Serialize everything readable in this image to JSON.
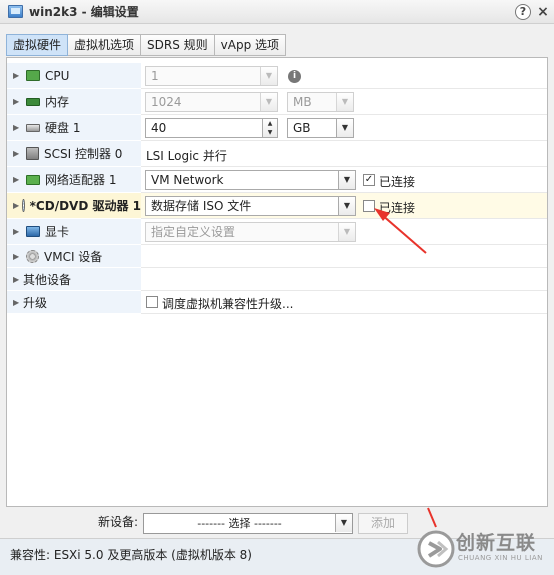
{
  "window": {
    "title": "win2k3 - 编辑设置",
    "help_icon": "?",
    "close_icon": "×"
  },
  "tabs": [
    {
      "label": "虚拟硬件",
      "active": true
    },
    {
      "label": "虚拟机选项",
      "active": false
    },
    {
      "label": "SDRS 规则",
      "active": false
    },
    {
      "label": "vApp 选项",
      "active": false
    }
  ],
  "hardware": {
    "cpu": {
      "label": "CPU",
      "value": "1",
      "icon": "cpu-icon",
      "info": "i"
    },
    "memory": {
      "label": "内存",
      "value": "1024",
      "unit": "MB",
      "icon": "memory-icon"
    },
    "disk": {
      "label": "硬盘 1",
      "value": "40",
      "unit": "GB",
      "icon": "disk-icon"
    },
    "scsi": {
      "label": "SCSI 控制器 0",
      "value": "LSI Logic 并行",
      "icon": "scsi-controller-icon"
    },
    "network": {
      "label": "网络适配器 1",
      "value": "VM Network",
      "connected_label": "已连接",
      "connected": true,
      "icon": "network-adapter-icon"
    },
    "cdrom": {
      "label": "*CD/DVD 驱动器 1",
      "value": "数据存储 ISO 文件",
      "connected_label": "已连接",
      "connected": false,
      "icon": "cd-dvd-icon"
    },
    "video": {
      "label": "显卡",
      "value": "指定自定义设置",
      "icon": "video-card-icon"
    },
    "vmci": {
      "label": "VMCI 设备",
      "icon": "vmci-icon"
    },
    "other": {
      "label": "其他设备"
    },
    "upgrade": {
      "label": "升级",
      "checkbox_label": "调度虚拟机兼容性升级...",
      "checked": false
    }
  },
  "new_device": {
    "label": "新设备:",
    "select_value": "------- 选择 -------",
    "add_label": "添加"
  },
  "footer": {
    "compat_text": "兼容性: ESXi 5.0 及更高版本 (虚拟机版本 8)"
  },
  "watermark": {
    "name_cn": "创新互联",
    "name_en": "CHUANG XIN HU LIAN"
  },
  "colors": {
    "tab_active": "#cfe3f8",
    "label_column": "#eef4fb",
    "highlight_row": "#fdf6d6",
    "annotation_arrow": "#e8332b"
  }
}
